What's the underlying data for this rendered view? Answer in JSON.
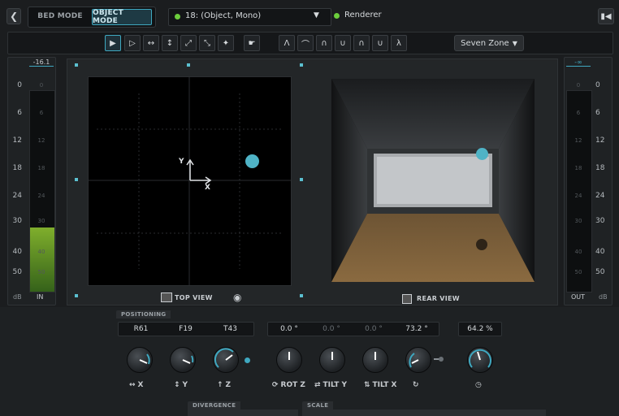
{
  "header": {
    "bed_mode_label": "BED MODE",
    "object_mode_label": "OBJECT MODE",
    "track_label": "18: (Object, Mono)",
    "renderer_label": "Renderer",
    "status_color": "#6ccd3c"
  },
  "toolbar": {
    "zone_label": "Seven Zone"
  },
  "meter_in": {
    "peak_value": "-16.1",
    "ticks": [
      "0",
      "6",
      "12",
      "18",
      "24",
      "30",
      "40",
      "50"
    ],
    "unit_label": "dB",
    "channel_label": "IN",
    "level_fraction": 0.32
  },
  "meter_out": {
    "peak_value": "-∞",
    "ticks": [
      "0",
      "6",
      "12",
      "18",
      "24",
      "30",
      "40",
      "50"
    ],
    "unit_label": "dB",
    "channel_label": "OUT"
  },
  "top_view": {
    "label": "TOP VIEW",
    "axis_y": "Y",
    "axis_x": "X"
  },
  "rear_view": {
    "label": "REAR VIEW"
  },
  "positioning": {
    "section_label": "POSITIONING",
    "zones": [
      "R61",
      "F19",
      "T43"
    ],
    "rotations": [
      "0.0 °",
      "0.0 °",
      "0.0 °",
      "73.2 °"
    ],
    "size": "64.2 %"
  },
  "knobs": [
    {
      "label": "X"
    },
    {
      "label": "Y"
    },
    {
      "label": "Z"
    },
    {
      "label": "ROT Z"
    },
    {
      "label": "TILT Y"
    },
    {
      "label": "TILT X"
    },
    {
      "label": ""
    },
    {
      "label": ""
    }
  ],
  "bottom_tabs": {
    "divergence_label": "DIVERGENCE",
    "scale_label": "SCALE"
  },
  "colors": {
    "accent": "#3fa8c0",
    "object_dot": "#4fb3c6",
    "meter_green": "#6a9a2a"
  }
}
